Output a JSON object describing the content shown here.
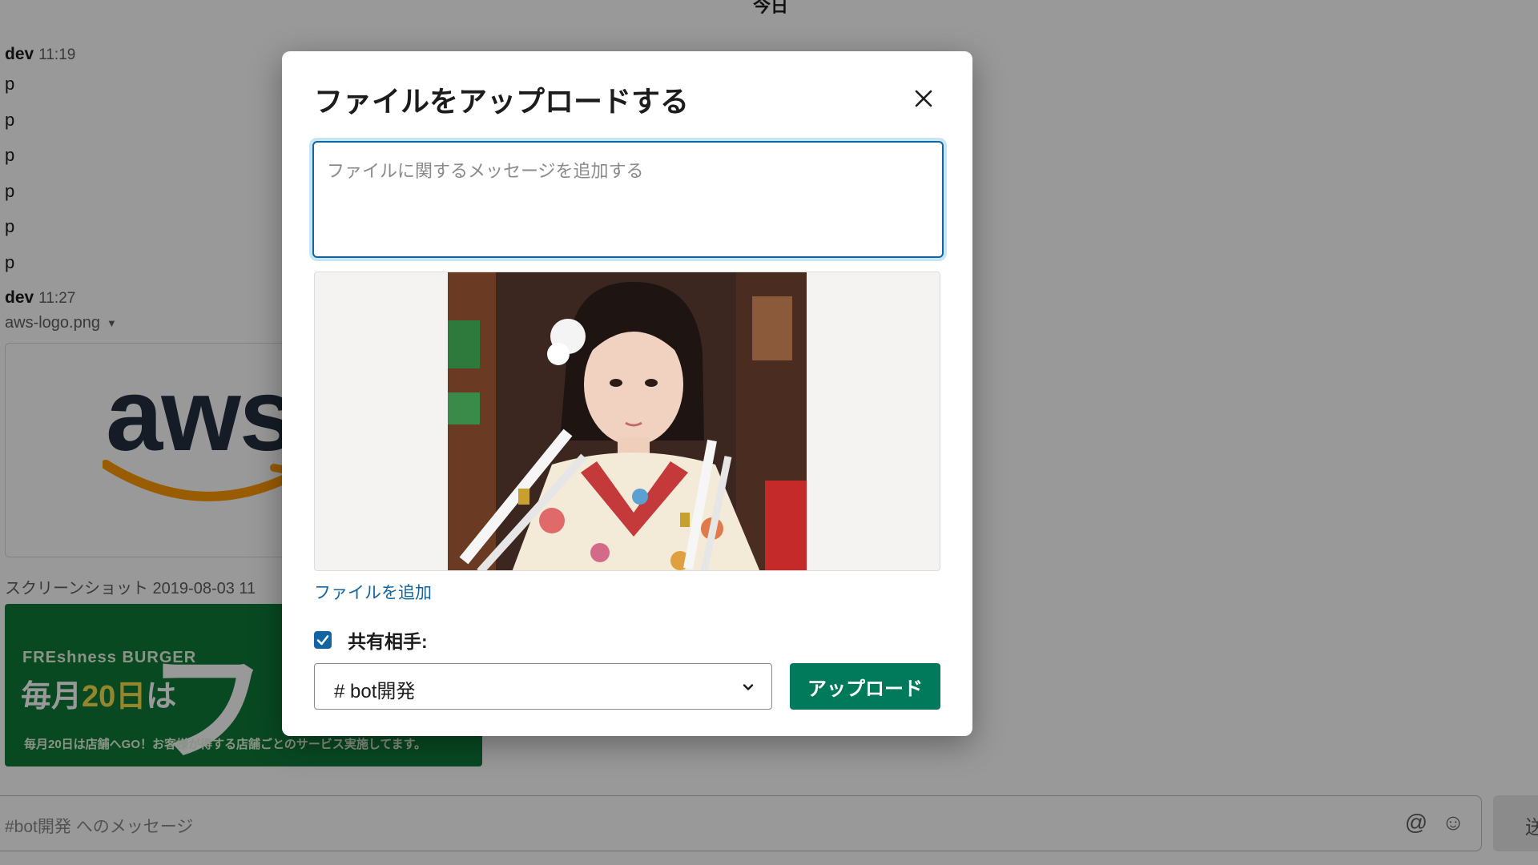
{
  "background": {
    "date_divider": "今日",
    "messages": [
      {
        "author": "dev",
        "time": "11:19",
        "lines": [
          "p",
          "p",
          "p",
          "p",
          "p",
          "p"
        ]
      },
      {
        "author": "dev",
        "time": "11:27",
        "file_name": "aws-logo.png",
        "aws_logo_text": "aws"
      }
    ],
    "screenshot_name": "スクリーンショット 2019-08-03 11",
    "banner": {
      "brand": "FREshness BURGER",
      "headline_prefix": "毎月",
      "headline_highlight": "20日",
      "headline_suffix": "は",
      "big_kana": "フ",
      "footer": "毎月20日は店舗へGO！お客様が得する店舗ごとのサービス実施してます。"
    },
    "composer": {
      "placeholder": "#bot開発 へのメッセージ",
      "send_label": "送"
    }
  },
  "modal": {
    "title": "ファイルをアップロードする",
    "message_placeholder": "ファイルに関するメッセージを追加する",
    "add_file_link": "ファイルを追加",
    "share_checked": true,
    "share_label": "共有相手:",
    "channel_value": "# bot開発",
    "upload_label": "アップロード"
  },
  "icons": {
    "close": "close-icon",
    "checkbox": "check-icon",
    "select": "chevron-down-icon",
    "mention": "at-sign-icon",
    "emoji": "emoji-smile-icon",
    "file_menu": "caret-down-icon"
  },
  "colors": {
    "primary_button": "#007a5a",
    "link": "#1264a3",
    "focus_border": "#1264a3",
    "banner_green": "#0e7a3a"
  }
}
